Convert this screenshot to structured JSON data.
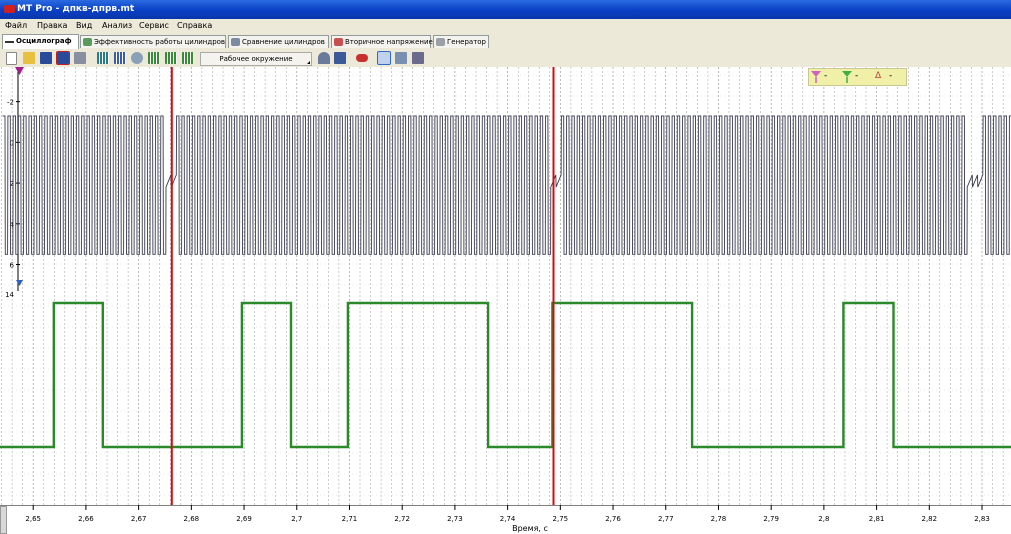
{
  "window": {
    "title": "MT Pro - дпкв-дпрв.mt"
  },
  "menu": [
    "Файл",
    "Правка",
    "Вид",
    "Анализ",
    "Сервис",
    "Справка"
  ],
  "tabs": [
    {
      "label": "Осциллограф",
      "active": true,
      "icon": "oscilloscope-icon"
    },
    {
      "label": "Эффективность работы цилиндров",
      "active": false,
      "icon": "cylinders-efficiency-icon"
    },
    {
      "label": "Сравнение цилиндров",
      "active": false,
      "icon": "cylinders-compare-icon"
    },
    {
      "label": "Вторичное напряжение",
      "active": false,
      "icon": "secondary-voltage-icon"
    },
    {
      "label": "Генератор",
      "active": false,
      "icon": "generator-icon"
    }
  ],
  "toolbar": {
    "workspace": "Рабочее окружение",
    "buttons": [
      "new-file-icon",
      "open-folder-icon",
      "save-icon",
      "save-as-icon",
      "export-icon",
      "channel-1-icon",
      "channel-2-icon",
      "link-icon",
      "channel-3-icon",
      "channel-4-icon",
      "channel-5-icon",
      "undo-icon",
      "save-view-icon",
      "car-icon",
      "cursor-mode-icon",
      "zoom-mode-icon",
      "grid-mode-icon"
    ]
  },
  "cursors": {
    "marker_a": "-",
    "marker_b": "-",
    "delta": "-",
    "delta_symbol": "Δ"
  },
  "colors": {
    "analog": "#3a3a50",
    "digital": "#2a8a2a",
    "cursor": "#cc1010",
    "grid": "#9a9a9a",
    "marker_a": "#d060c0",
    "marker_b": "#40b040"
  },
  "chart_data": {
    "type": "line",
    "xlabel": "Время, с",
    "xlim": [
      2.8437,
      2.8355
    ],
    "x_ticks": [
      "2,65",
      "2,66",
      "2,67",
      "2,68",
      "2,69",
      "2,7",
      "2,71",
      "2,72",
      "2,73",
      "2,74",
      "2,75",
      "2,76",
      "2,77",
      "2,78",
      "2,79",
      "2,8",
      "2,81",
      "2,82",
      "2,83"
    ],
    "x_tick_values": [
      2.65,
      2.66,
      2.67,
      2.68,
      2.69,
      2.7,
      2.71,
      2.72,
      2.73,
      2.74,
      2.75,
      2.76,
      2.77,
      2.78,
      2.79,
      2.8,
      2.81,
      2.82,
      2.83
    ],
    "y_ticks": [
      "-2",
      "0",
      "2",
      "4",
      "6"
    ],
    "y_tick_values": [
      -2,
      0,
      2,
      4,
      6
    ],
    "y_extra_label": "14",
    "ylim": [
      -3.7,
      7.3
    ],
    "cursors_x": [
      2.6763,
      2.7487
    ],
    "series": [
      {
        "kind": "analog",
        "period": 0.001,
        "high": -1.3,
        "low": 5.5,
        "sync_gaps_x": [
          2.6758,
          2.7485,
          2.8281
        ]
      },
      {
        "kind": "digital",
        "levels": {
          "high": 1,
          "low": 0
        },
        "edges": [
          {
            "x": 2.6463,
            "v": 0
          },
          {
            "x": 2.6539,
            "v": 1
          },
          {
            "x": 2.6632,
            "v": 0
          },
          {
            "x": 2.6896,
            "v": 1
          },
          {
            "x": 2.6989,
            "v": 0
          },
          {
            "x": 2.7097,
            "v": 1
          },
          {
            "x": 2.7363,
            "v": 0
          },
          {
            "x": 2.7485,
            "v": 1
          },
          {
            "x": 2.775,
            "v": 0
          },
          {
            "x": 2.8037,
            "v": 1
          },
          {
            "x": 2.8132,
            "v": 0
          },
          {
            "x": 2.8397,
            "v": 0
          }
        ]
      }
    ]
  }
}
